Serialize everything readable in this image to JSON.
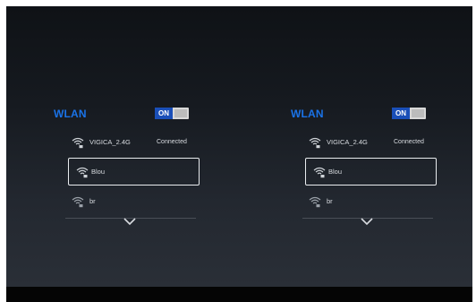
{
  "panels": [
    {
      "title": "WLAN",
      "toggle": {
        "label": "ON",
        "state": "on"
      },
      "networks": [
        {
          "ssid": "VIGICA_2.4G",
          "status": "Connected",
          "secured": true
        },
        {
          "ssid": "Blou",
          "status": "",
          "secured": true,
          "selected": true
        },
        {
          "ssid": "br",
          "status": "",
          "secured": true
        }
      ],
      "more_icon": "chevron-down-icon"
    },
    {
      "title": "WLAN",
      "toggle": {
        "label": "ON",
        "state": "on"
      },
      "networks": [
        {
          "ssid": "VIGICA_2.4G",
          "status": "Connected",
          "secured": true
        },
        {
          "ssid": "Blou",
          "status": "",
          "secured": true,
          "selected": true
        },
        {
          "ssid": "br",
          "status": "",
          "secured": true
        }
      ],
      "more_icon": "chevron-down-icon"
    }
  ],
  "colors": {
    "accent": "#1a73e8",
    "toggle_on": "#1a4fb8",
    "text": "#d8dbe0",
    "selection_border": "#e9ecef"
  }
}
